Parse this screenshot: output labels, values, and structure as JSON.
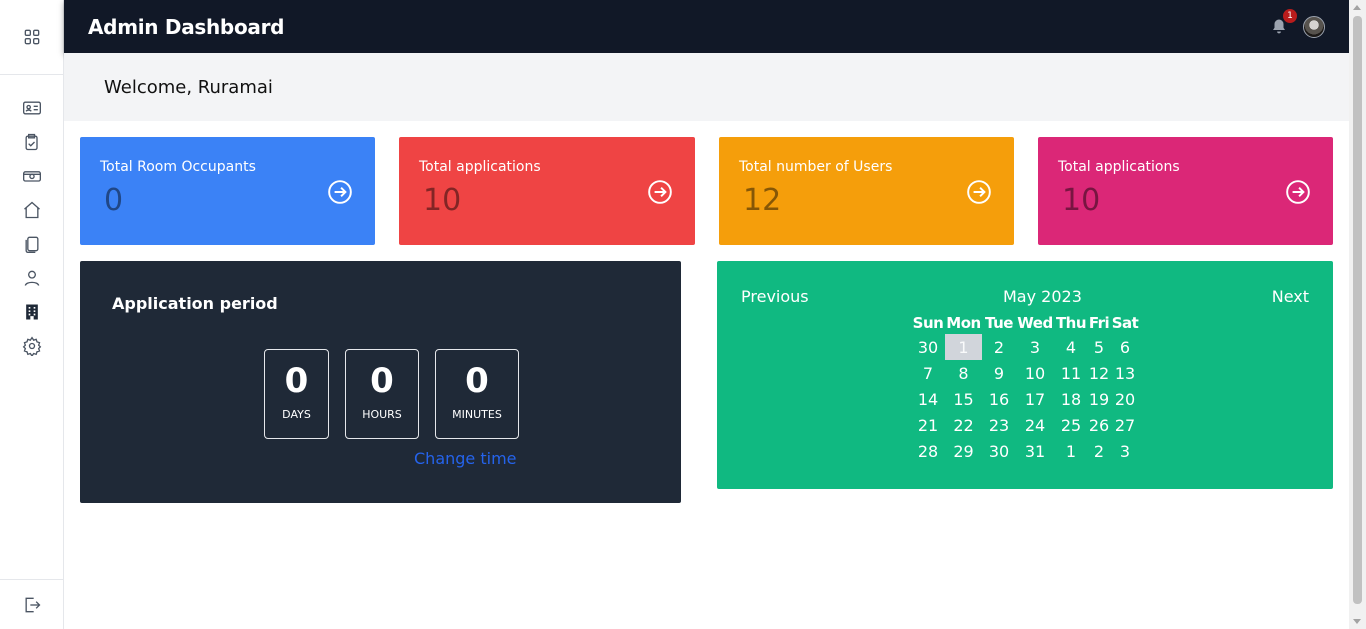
{
  "header": {
    "title": "Admin Dashboard",
    "notification_count": "1",
    "bell_icon": "bell-icon",
    "avatar_icon": "user-avatar"
  },
  "welcome": {
    "text": "Welcome, Ruramai"
  },
  "sidebar": {
    "top_icon": "grid-icon",
    "items": [
      {
        "icon": "id-card-icon"
      },
      {
        "icon": "clipboard-check-icon"
      },
      {
        "icon": "money-icon"
      },
      {
        "icon": "home-icon"
      },
      {
        "icon": "copy-icon"
      },
      {
        "icon": "user-icon"
      },
      {
        "icon": "building-icon"
      },
      {
        "icon": "gear-icon"
      }
    ],
    "bottom_icon": "logout-icon"
  },
  "stats": [
    {
      "title": "Total Room Occupants",
      "value": "0",
      "color": "#3b82f6"
    },
    {
      "title": "Total applications",
      "value": "10",
      "color": "#ef4444"
    },
    {
      "title": "Total number of Users",
      "value": "12",
      "color": "#f59e0b"
    },
    {
      "title": "Total applications",
      "value": "10",
      "color": "#db2777"
    }
  ],
  "application_period": {
    "title": "Application period",
    "countdown": [
      {
        "value": "0",
        "label": "DAYS"
      },
      {
        "value": "0",
        "label": "HOURS"
      },
      {
        "value": "0",
        "label": "MINUTES"
      }
    ],
    "change_label": "Change time"
  },
  "calendar": {
    "prev_label": "Previous",
    "next_label": "Next",
    "month_label": "May 2023",
    "weekdays": [
      "Sun",
      "Mon",
      "Tue",
      "Wed",
      "Thu",
      "Fri",
      "Sat"
    ],
    "weeks": [
      [
        "30",
        "1",
        "2",
        "3",
        "4",
        "5",
        "6"
      ],
      [
        "7",
        "8",
        "9",
        "10",
        "11",
        "12",
        "13"
      ],
      [
        "14",
        "15",
        "16",
        "17",
        "18",
        "19",
        "20"
      ],
      [
        "21",
        "22",
        "23",
        "24",
        "25",
        "26",
        "27"
      ],
      [
        "28",
        "29",
        "30",
        "31",
        "1",
        "2",
        "3"
      ]
    ],
    "highlighted_day": "1",
    "color": "#10b981"
  }
}
